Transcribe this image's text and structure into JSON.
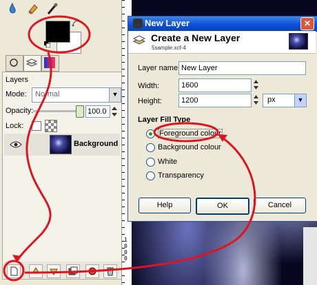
{
  "layers_panel": {
    "title": "Layers",
    "mode_label": "Mode:",
    "mode_value": "Normal",
    "opacity_label": "Opacity:",
    "opacity_value": "100.0",
    "lock_label": "Lock:",
    "layer_name": "Background"
  },
  "ruler": {
    "marks": "1 0 0 0"
  },
  "dialog": {
    "window_title": "New Layer",
    "close_glyph": "✕",
    "header_title": "Create a New Layer",
    "header_subtitle": "5sample.xcf-4",
    "layer_name_label": "Layer name:",
    "layer_name_value": "New Layer",
    "width_label": "Width:",
    "width_value": "1600",
    "height_label": "Height:",
    "height_value": "1200",
    "unit_value": "px",
    "fill_type_heading": "Layer Fill Type",
    "fill_options": [
      {
        "label": "Foreground colour",
        "selected": true
      },
      {
        "label": "Background colour",
        "selected": false
      },
      {
        "label": "White",
        "selected": false
      },
      {
        "label": "Transparency",
        "selected": false
      }
    ],
    "help_label": "Help",
    "ok_label": "OK",
    "cancel_label": "Cancel"
  },
  "colors": {
    "titlebar": "#0c4fd6",
    "dialog_bg": "#ece9d8",
    "annotation": "#e0141e",
    "selected_radio": "#2b9a1c"
  },
  "icons": [
    "paint-bucket-icon",
    "smudge-icon",
    "text-icon",
    "swap-colors-icon",
    "eye-icon",
    "new-layer-icon",
    "raise-layer-icon",
    "lower-layer-icon",
    "duplicate-layer-icon",
    "anchor-layer-icon",
    "delete-layer-icon",
    "close-icon"
  ]
}
